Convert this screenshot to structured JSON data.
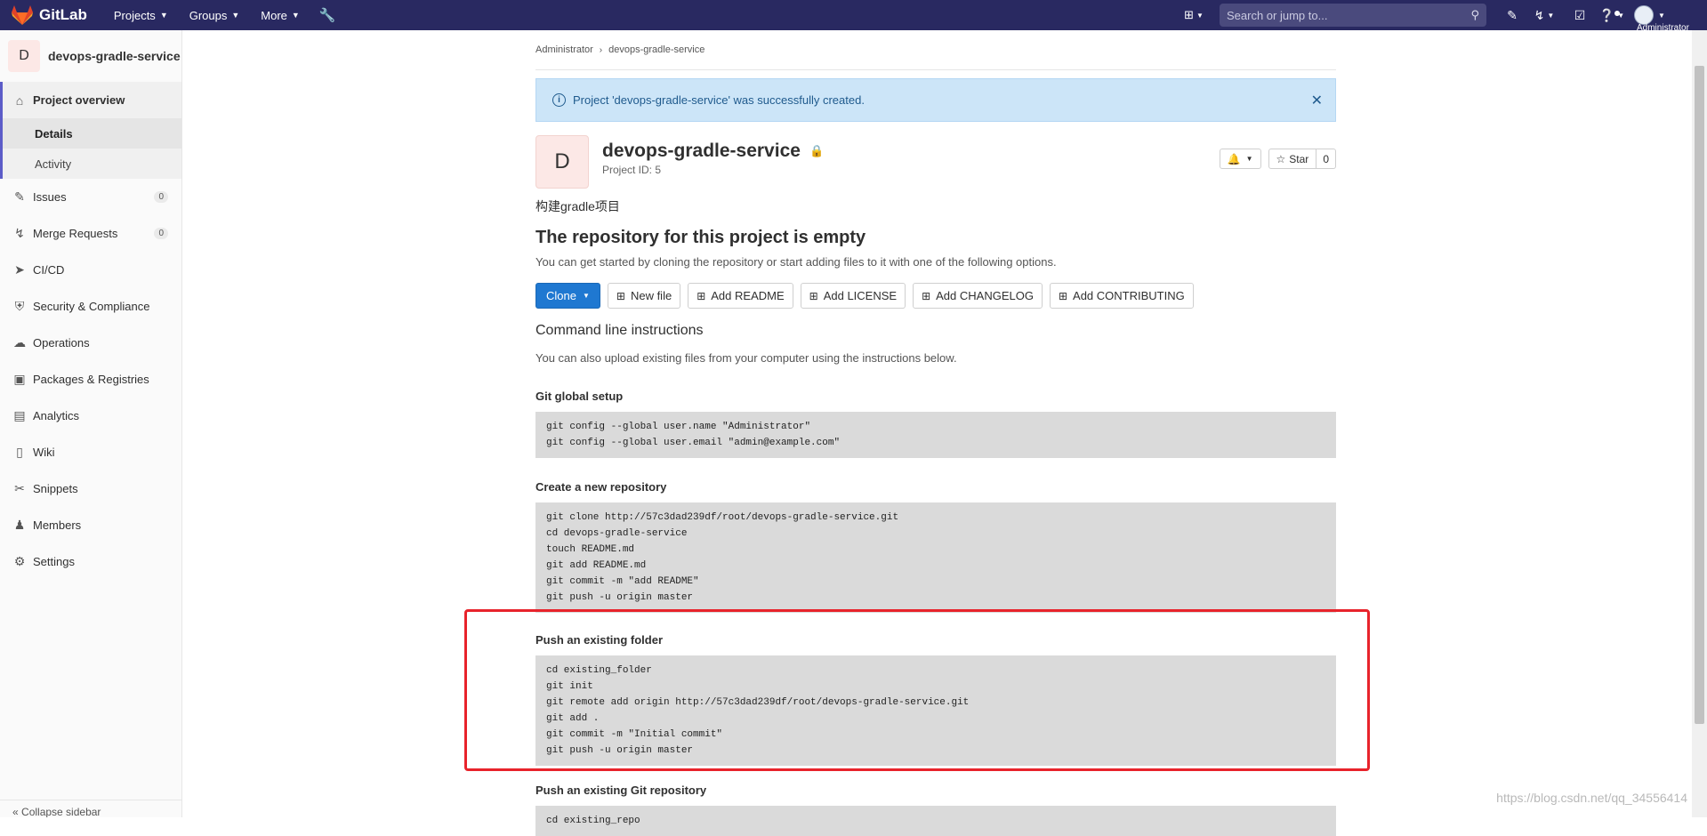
{
  "topbar": {
    "brand": "GitLab",
    "nav": [
      {
        "label": "Projects"
      },
      {
        "label": "Groups"
      },
      {
        "label": "More"
      }
    ],
    "search_placeholder": "Search or jump to...",
    "user_name": "Administrator"
  },
  "sidebar": {
    "project_letter": "D",
    "project_name": "devops-gradle-service",
    "overview_label": "Project overview",
    "sub_items": [
      "Details",
      "Activity"
    ],
    "items": [
      {
        "label": "Issues",
        "count": "0"
      },
      {
        "label": "Merge Requests",
        "count": "0"
      },
      {
        "label": "CI/CD"
      },
      {
        "label": "Security & Compliance"
      },
      {
        "label": "Operations"
      },
      {
        "label": "Packages & Registries"
      },
      {
        "label": "Analytics"
      },
      {
        "label": "Wiki"
      },
      {
        "label": "Snippets"
      },
      {
        "label": "Members"
      },
      {
        "label": "Settings"
      }
    ],
    "collapse_label": "Collapse sidebar"
  },
  "breadcrumb": [
    "Administrator",
    "devops-gradle-service"
  ],
  "alert": {
    "message": "Project 'devops-gradle-service' was successfully created."
  },
  "project": {
    "letter": "D",
    "name": "devops-gradle-service",
    "id_text": "Project ID: 5",
    "star_label": "Star",
    "star_count": "0",
    "description": "构建gradle项目"
  },
  "empty": {
    "title": "The repository for this project is empty",
    "help": "You can get started by cloning the repository or start adding files to it with one of the following options.",
    "buttons": {
      "clone": "Clone",
      "new_file": "New file",
      "readme": "Add README",
      "license": "Add LICENSE",
      "changelog": "Add CHANGELOG",
      "contributing": "Add CONTRIBUTING"
    }
  },
  "cli": {
    "title": "Command line instructions",
    "help": "You can also upload existing files from your computer using the instructions below.",
    "sections": [
      {
        "title": "Git global setup",
        "code": "git config --global user.name \"Administrator\"\ngit config --global user.email \"admin@example.com\""
      },
      {
        "title": "Create a new repository",
        "code": "git clone http://57c3dad239df/root/devops-gradle-service.git\ncd devops-gradle-service\ntouch README.md\ngit add README.md\ngit commit -m \"add README\"\ngit push -u origin master"
      },
      {
        "title": "Push an existing folder",
        "code": "cd existing_folder\ngit init\ngit remote add origin http://57c3dad239df/root/devops-gradle-service.git\ngit add .\ngit commit -m \"Initial commit\"\ngit push -u origin master"
      },
      {
        "title": "Push an existing Git repository",
        "code": "cd existing_repo"
      }
    ]
  },
  "watermark": "https://blog.csdn.net/qq_34556414",
  "colors": {
    "topbar": "#292961",
    "primary": "#1f78d1",
    "highlight": "#e8232b"
  }
}
